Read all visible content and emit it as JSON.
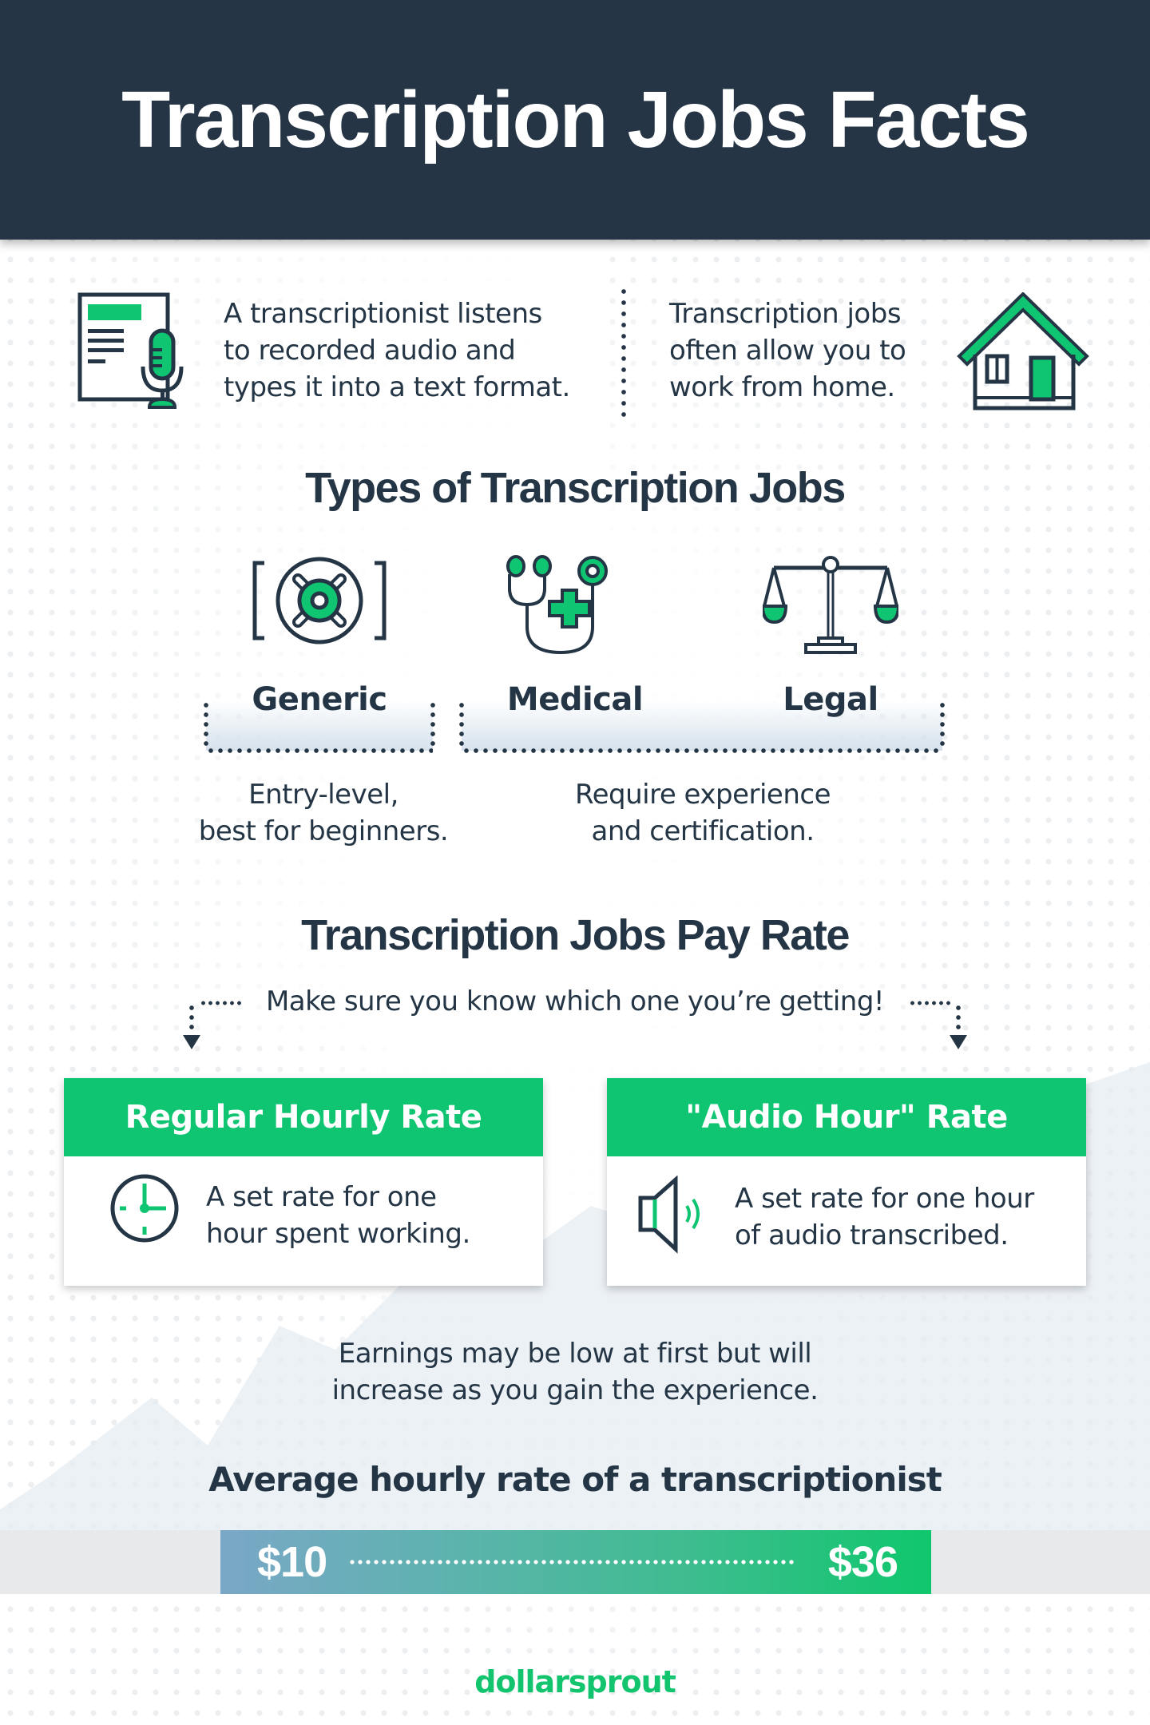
{
  "header": {
    "title": "Transcription Jobs Facts"
  },
  "intro": {
    "left": {
      "icon": "document-microphone-icon",
      "lines": [
        "A transcriptionist listens",
        "to recorded audio and",
        "types it into a text format."
      ]
    },
    "right": {
      "icon": "house-icon",
      "lines": [
        "Transcription jobs",
        "often allow you to",
        "work from home."
      ]
    }
  },
  "types": {
    "title": "Types of Transcription Jobs",
    "items": [
      {
        "label": "Generic",
        "icon": "reel-icon"
      },
      {
        "label": "Medical",
        "icon": "stethoscope-icon"
      },
      {
        "label": "Legal",
        "icon": "scales-icon"
      }
    ],
    "groups": [
      {
        "lines": [
          "Entry-level,",
          "best for beginners."
        ]
      },
      {
        "lines": [
          "Require experience",
          "and certification."
        ]
      }
    ]
  },
  "pay": {
    "title": "Transcription Jobs Pay Rate",
    "subtitle": "Make sure you know which one you’re getting!",
    "cards": [
      {
        "title": "Regular Hourly Rate",
        "icon": "clock-icon",
        "lines": [
          "A set rate for one",
          "hour spent working."
        ]
      },
      {
        "title": "\"Audio Hour\" Rate",
        "icon": "speaker-icon",
        "lines": [
          "A set rate for one hour",
          "of audio transcribed."
        ]
      }
    ],
    "note": [
      "Earnings may be low at first but will",
      "increase as you gain the experience."
    ]
  },
  "average": {
    "title": "Average hourly rate of a transcriptionist",
    "min": "$10",
    "max": "$36"
  },
  "footer": {
    "logo": "dollarsprout"
  },
  "colors": {
    "navy": "#253545",
    "green": "#0fc572",
    "text": "#243545",
    "range_start": "#7aa7c7",
    "range_end": "#0fc76c"
  }
}
